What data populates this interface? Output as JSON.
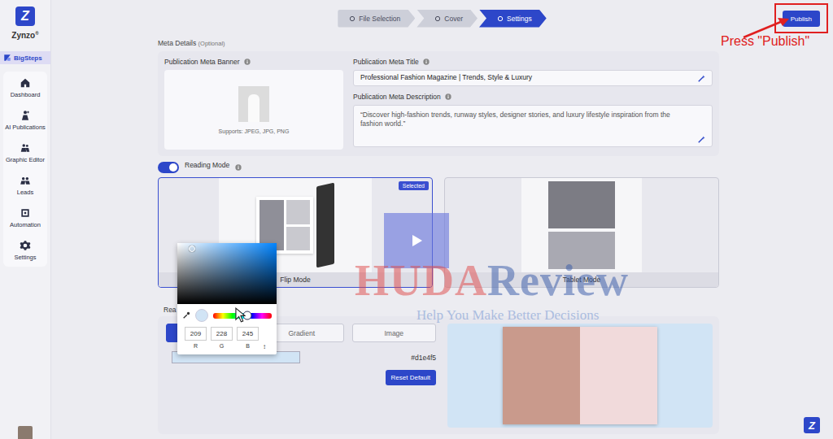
{
  "app": {
    "name": "Zynzo",
    "mark": "Z",
    "trademark": "®"
  },
  "sidebar": {
    "workspace": "BigSteps",
    "items": [
      {
        "label": "Dashboard",
        "selected": false
      },
      {
        "label": "AI Publications",
        "selected": false
      },
      {
        "label": "Graphic Editor",
        "selected": false
      },
      {
        "label": "Leads",
        "selected": false
      },
      {
        "label": "Automation",
        "selected": false
      },
      {
        "label": "Settings",
        "selected": false
      }
    ]
  },
  "steps": [
    {
      "label": "File Selection",
      "selected": false
    },
    {
      "label": "Cover",
      "selected": false
    },
    {
      "label": "Settings",
      "selected": true
    }
  ],
  "publish_button": "Publish",
  "annotation": "Press \"Publish\"",
  "meta": {
    "heading": "Meta Details",
    "optional": "(Optional)",
    "banner_label": "Publication Meta Banner",
    "banner_hint": "Supports: JPEG, JPG, PNG",
    "title_label": "Publication Meta Title",
    "title_value": "Professional Fashion Magazine | Trends, Style & Luxury",
    "description_label": "Publication Meta Description",
    "description_value": "“Discover high-fashion trends, runway styles, designer stories, and luxury lifestyle inspiration from the fashion world.”"
  },
  "reading_mode": {
    "label": "Reading Mode",
    "on": true,
    "modes": [
      {
        "label": "Flip Mode",
        "selected": true,
        "badge": "Selected"
      },
      {
        "label": "Tablet Mode",
        "selected": false,
        "badge": ""
      }
    ]
  },
  "background": {
    "label": "Rea",
    "tabs": [
      {
        "label": "",
        "selected": true
      },
      {
        "label": "Gradient",
        "selected": false
      },
      {
        "label": "Image",
        "selected": false
      }
    ],
    "color": "#d1e4f5",
    "reset_button": "Reset Default"
  },
  "color_picker": {
    "hue": {
      "level": 0.58
    },
    "channels": [
      {
        "label": "R",
        "value": "209"
      },
      {
        "label": "G",
        "value": "228"
      },
      {
        "label": "B",
        "value": "245"
      }
    ],
    "toggle": "↕"
  },
  "watermark": {
    "title_parts": [
      {
        "text": "HUDA",
        "color": "#e04848"
      },
      {
        "text": "Review",
        "color": "#3558a8"
      }
    ],
    "subtitle": "Help You Make Better Decisions"
  }
}
